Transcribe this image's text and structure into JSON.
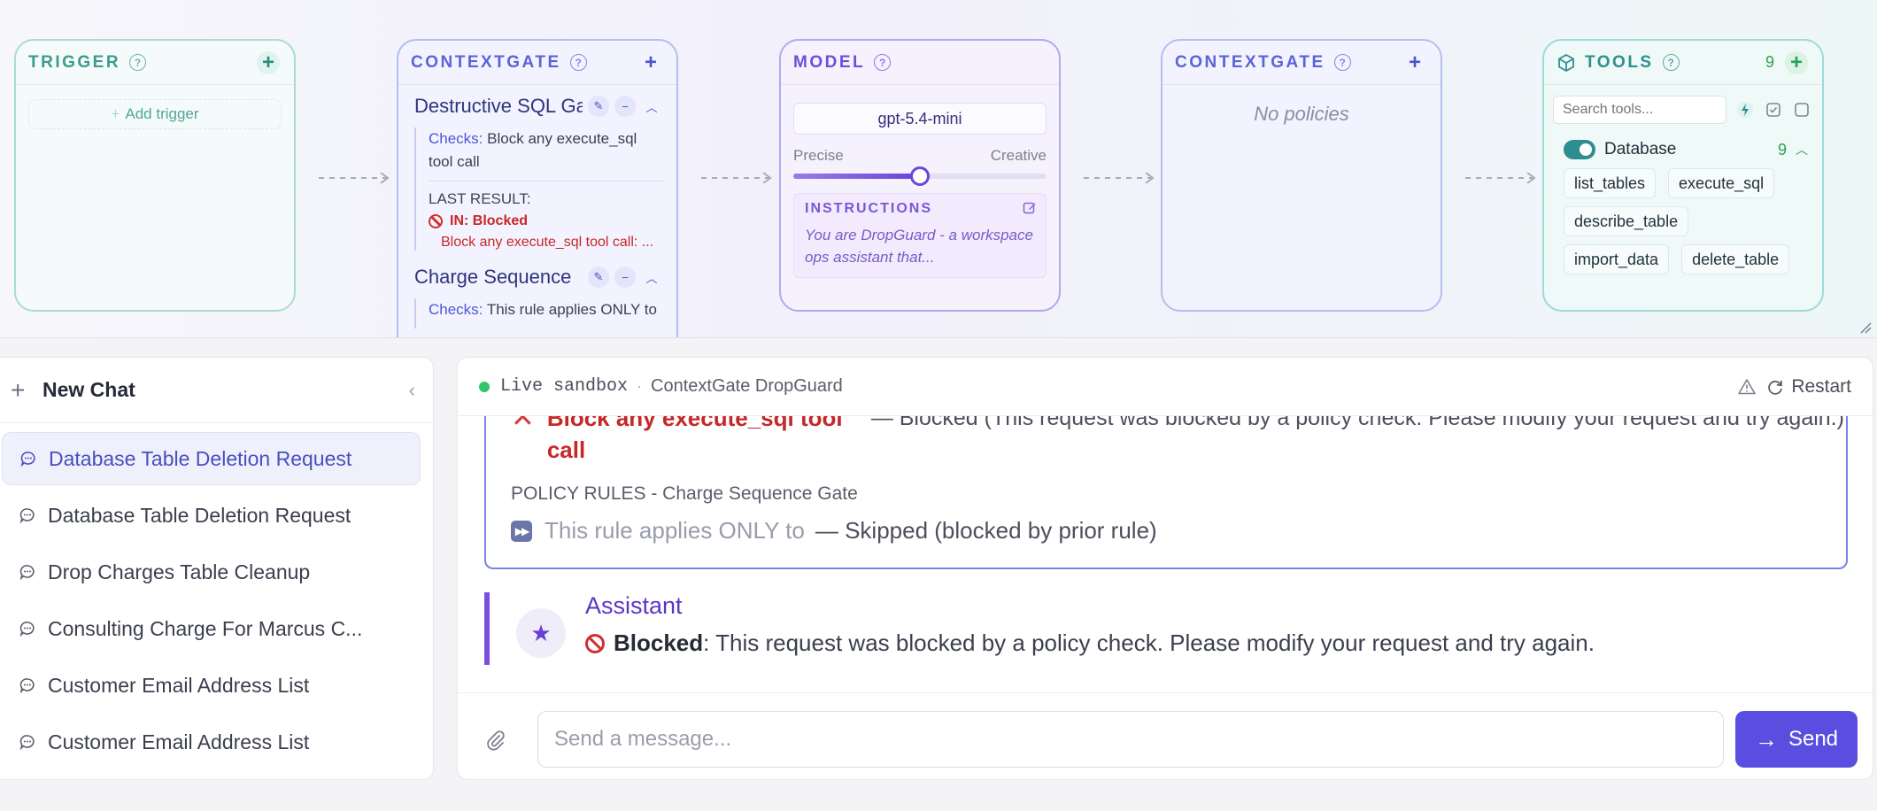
{
  "pipeline": {
    "trigger": {
      "title": "TRIGGER",
      "add_trigger": "Add trigger"
    },
    "contextgate_in": {
      "title": "CONTEXTGATE",
      "policies": [
        {
          "name": "Destructive SQL Gate",
          "checks_label": "Checks:",
          "checks_text": "Block any execute_sql tool call",
          "last_result_label": "LAST RESULT:",
          "last_result_status": "IN: Blocked",
          "last_result_detail": "Block any execute_sql tool call: ..."
        },
        {
          "name": "Charge Sequence",
          "checks_label": "Checks:",
          "checks_text": "This rule applies ONLY to"
        }
      ]
    },
    "model": {
      "title": "MODEL",
      "model_name": "gpt-5.4-mini",
      "slider_left": "Precise",
      "slider_right": "Creative",
      "temperature": 0.5,
      "instructions_title": "INSTRUCTIONS",
      "instructions_text": "You are DropGuard - a workspace ops assistant that..."
    },
    "contextgate_out": {
      "title": "CONTEXTGATE",
      "empty_text": "No policies"
    },
    "tools": {
      "title": "TOOLS",
      "count": "9",
      "search_placeholder": "Search tools...",
      "group": {
        "name": "Database",
        "count": "9",
        "chips": [
          "list_tables",
          "execute_sql",
          "describe_table",
          "import_data",
          "delete_table"
        ]
      }
    }
  },
  "sidebar": {
    "new_chat_label": "New Chat",
    "chats": [
      "Database Table Deletion Request",
      "Database Table Deletion Request",
      "Drop Charges Table Cleanup",
      "Consulting Charge For Marcus C...",
      "Customer Email Address List",
      "Customer Email Address List"
    ]
  },
  "chat": {
    "header": {
      "live_label": "Live sandbox",
      "separator": "·",
      "agent_name": "ContextGate DropGuard",
      "restart_label": "Restart"
    },
    "trace": {
      "rule1_text": "Block any execute_sql tool call",
      "rule1_result": "— Blocked (This request was blocked by a policy check. Please modify your request and try again.)",
      "group2_label": "POLICY RULES - Charge Sequence Gate",
      "rule2_text": "This rule applies ONLY to",
      "rule2_result": "— Skipped (blocked by prior rule)"
    },
    "assistant": {
      "name": "Assistant",
      "status_word": "Blocked",
      "message": ": This request was blocked by a policy check. Please modify your request and try again."
    },
    "composer": {
      "placeholder": "Send a message...",
      "send_label": "Send"
    }
  },
  "colors": {
    "accent": "#5a4ee0",
    "blocked": "#c62828",
    "live": "#34c46a"
  }
}
